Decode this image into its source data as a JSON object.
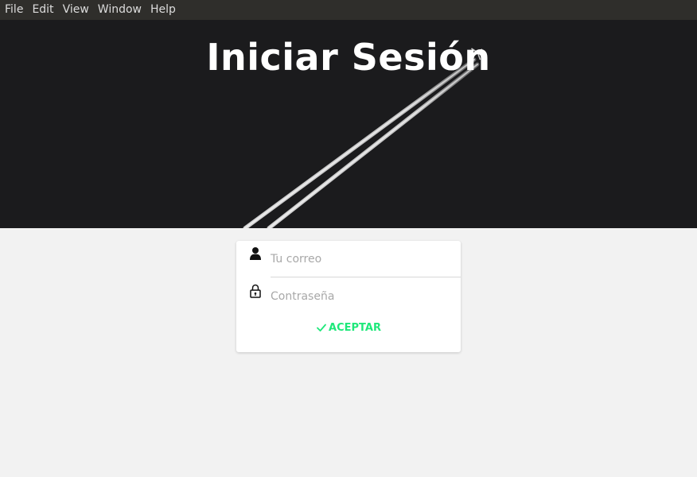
{
  "menubar": {
    "items": [
      {
        "label": "File"
      },
      {
        "label": "Edit"
      },
      {
        "label": "View"
      },
      {
        "label": "Window"
      },
      {
        "label": "Help"
      }
    ]
  },
  "hero": {
    "title": "Iniciar Sesión",
    "background_color": "#1b1b1d"
  },
  "login_form": {
    "email_placeholder": "Tu correo",
    "email_value": "",
    "email_icon": "user-icon",
    "password_placeholder": "Contraseña",
    "password_value": "",
    "password_icon": "lock-icon",
    "accept_label": "ACEPTAR",
    "accept_icon": "checkmark-icon",
    "accent_color": "#1ee87a"
  }
}
